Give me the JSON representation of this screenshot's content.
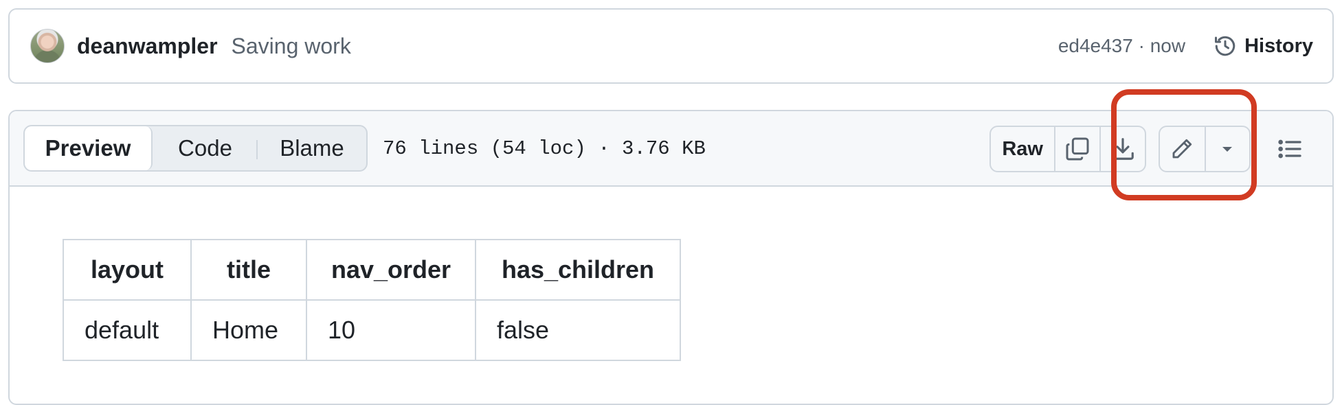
{
  "commit": {
    "author": "deanwampler",
    "message": "Saving work",
    "hash_time": "ed4e437 · now",
    "history_label": "History"
  },
  "toolbar": {
    "tabs": [
      {
        "label": "Preview",
        "active": true
      },
      {
        "label": "Code",
        "active": false
      },
      {
        "label": "Blame",
        "active": false
      }
    ],
    "file_info": "76 lines (54 loc) · 3.76 KB",
    "raw_label": "Raw",
    "icons": {
      "copy": "copy-icon",
      "download": "download-icon",
      "edit": "pencil-icon",
      "dropdown": "triangle-down-icon",
      "outline": "list-unordered-icon",
      "history": "history-icon"
    }
  },
  "table": {
    "headers": [
      "layout",
      "title",
      "nav_order",
      "has_children"
    ],
    "rows": [
      [
        "default",
        "Home",
        "10",
        "false"
      ]
    ]
  },
  "colors": {
    "border": "#d0d7de",
    "header_bg": "#f6f8fa",
    "highlight": "#d13b22",
    "muted_text": "#59636e"
  }
}
